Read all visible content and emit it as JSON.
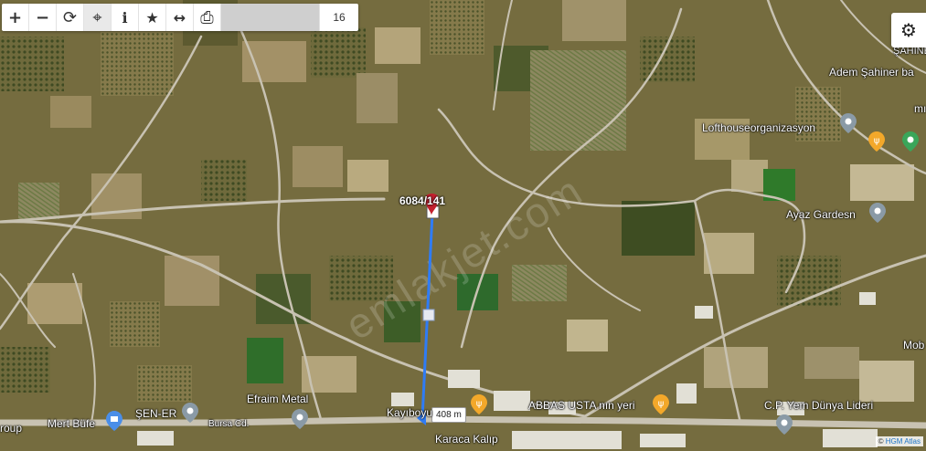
{
  "toolbar": {
    "buttons": [
      {
        "icon": "plus-icon",
        "glyph": "+"
      },
      {
        "icon": "minus-icon",
        "glyph": "−"
      },
      {
        "icon": "refresh-icon",
        "glyph": "⟳"
      },
      {
        "icon": "crosshair-icon",
        "glyph": "⌖"
      },
      {
        "icon": "info-icon",
        "glyph": "i"
      },
      {
        "icon": "star-icon",
        "glyph": "★"
      },
      {
        "icon": "measure-icon",
        "glyph": "↔"
      },
      {
        "icon": "print-icon",
        "glyph": "⎙"
      }
    ],
    "zoom_level": "16"
  },
  "settings_icon": "gear-icon",
  "parcel": {
    "label": "6084/141"
  },
  "measure": {
    "distance": "408 m"
  },
  "watermark": "emlakjet.com",
  "places": [
    {
      "name": "ŞAHINE",
      "type": "text"
    },
    {
      "name": "Adem Şahiner ba",
      "type": "text"
    },
    {
      "name": "mı",
      "type": "text"
    },
    {
      "name": "Lofthouseorganizasyon",
      "type": "pin"
    },
    {
      "name": "Ayaz Gardesn",
      "type": "pin"
    },
    {
      "name": "Mob",
      "type": "text"
    },
    {
      "name": "Efraim Metal",
      "type": "text"
    },
    {
      "name": "ABBAS USTA nın yeri",
      "type": "restaurant"
    },
    {
      "name": "Kayıboyu",
      "type": "text"
    },
    {
      "name": "C.P. Yem Dünya Lideri",
      "type": "pin"
    },
    {
      "name": "Mert Büfe",
      "type": "shop"
    },
    {
      "name": "ŞEN-ER",
      "type": "pin"
    },
    {
      "name": "Bursa Cd.",
      "type": "road"
    },
    {
      "name": "roup",
      "type": "text"
    },
    {
      "name": "Karaca Kalıp",
      "type": "text"
    }
  ],
  "credit": {
    "prefix": "©",
    "source": "HGM Atlas"
  },
  "colors": {
    "ground": "#7a7040",
    "road": "#c8c2b2",
    "measure_line": "#2f7cf6",
    "parcel_marker": "#c3202f"
  }
}
